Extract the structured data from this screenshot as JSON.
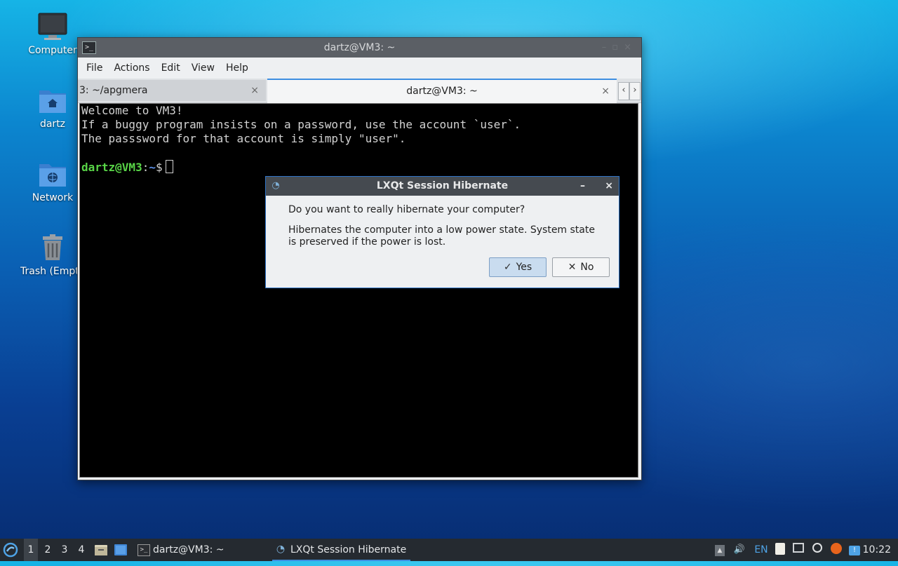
{
  "desktop": {
    "icons": [
      {
        "label": "Computer"
      },
      {
        "label": "dartz"
      },
      {
        "label": "Network"
      },
      {
        "label": "Trash (Empty)"
      }
    ]
  },
  "terminal": {
    "title": "dartz@VM3: ~",
    "menu": [
      "File",
      "Actions",
      "Edit",
      "View",
      "Help"
    ],
    "tabs": [
      {
        "label": "3: ~/apgmera",
        "close": "×"
      },
      {
        "label": "dartz@VM3: ~",
        "close": "×"
      }
    ],
    "scroll_left": "‹",
    "scroll_right": "›",
    "lines": [
      "Welcome to VM3!",
      "If a buggy program insists on a password, use the account `user`.",
      "The passsword for that account is simply \"user\"."
    ],
    "prompt": {
      "user": "dartz@VM3",
      "sep": ":",
      "path": "~",
      "symbol": "$"
    }
  },
  "dialog": {
    "title": "LXQt Session Hibernate",
    "question": "Do you want to really hibernate your computer?",
    "description": "Hibernates the computer into a low power state. System state is preserved if the power is lost.",
    "yes_label": "Yes",
    "no_label": "No",
    "minimize": "–",
    "close": "×"
  },
  "taskbar": {
    "workspaces": [
      "1",
      "2",
      "3",
      "4"
    ],
    "tasks": [
      {
        "label": "dartz@VM3: ~"
      },
      {
        "label": "LXQt Session Hibernate"
      }
    ],
    "keyboard_layout": "EN",
    "clock": "10:22"
  },
  "colors": {
    "accent": "#3d8ee0",
    "prompt_user": "#58d447",
    "prompt_path": "#5b8fe6"
  }
}
